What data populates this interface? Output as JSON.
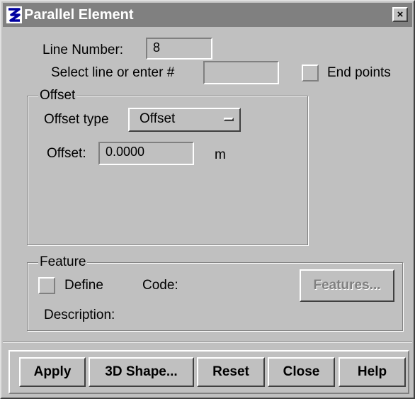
{
  "window": {
    "title": "Parallel Element",
    "close_label": "×",
    "icon": "app-logo-icon"
  },
  "line": {
    "number_label": "Line Number:",
    "number_value": "8",
    "select_label": "Select line or enter #",
    "select_value": "",
    "endpoints_label": "End points",
    "endpoints_checked": false
  },
  "offset_group": {
    "title": "Offset",
    "type_label": "Offset type",
    "type_value": "Offset",
    "offset_label": "Offset:",
    "offset_value": "0.0000",
    "unit": "m"
  },
  "feature_group": {
    "title": "Feature",
    "define_label": "Define",
    "define_checked": false,
    "code_label": "Code:",
    "features_button": "Features...",
    "description_label": "Description:"
  },
  "buttons": {
    "apply": "Apply",
    "shape3d": "3D Shape...",
    "reset": "Reset",
    "close": "Close",
    "help": "Help"
  },
  "colors": {
    "face": "#c0c0c0",
    "titlebar": "#808080",
    "disabled_text": "#808080"
  }
}
